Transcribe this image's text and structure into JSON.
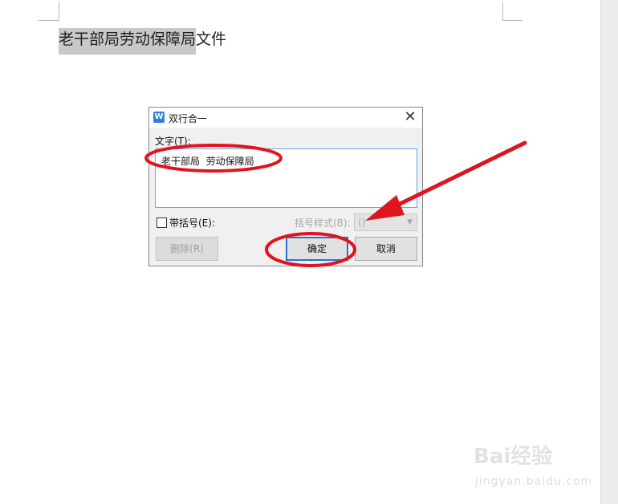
{
  "document": {
    "selected_text": "老干部局劳动保障局",
    "rest_text": "文件"
  },
  "dialog": {
    "title": "双行合一",
    "app_icon": "W",
    "close_glyph": "✕",
    "text_label": "文字(T):",
    "text_value": "老干部局  劳动保障局",
    "bracket_label": "带括号(E):",
    "bracket_checked": false,
    "bracket_style_label": "括号样式(B):",
    "bracket_style_value": "()",
    "delete_button": "删除(R)",
    "ok_button": "确定",
    "cancel_button": "取消"
  },
  "annotation": {
    "color": "#e0141e"
  },
  "watermark": {
    "main": "Bai经验",
    "sub": "jingyan.baidu.com"
  }
}
